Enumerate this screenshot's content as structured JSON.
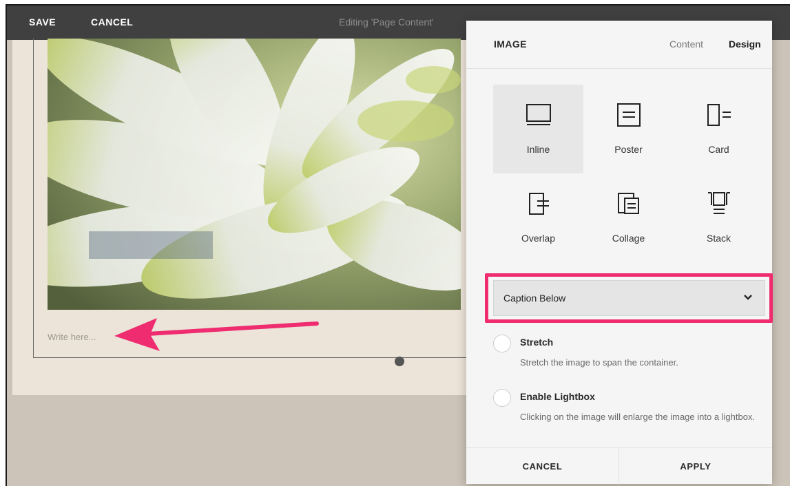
{
  "topbar": {
    "save_label": "SAVE",
    "cancel_label": "CANCEL",
    "editing_label": "Editing 'Page Content'"
  },
  "editor": {
    "caption_placeholder": "Write here..."
  },
  "panel": {
    "title": "IMAGE",
    "tabs": [
      {
        "label": "Content",
        "active": false
      },
      {
        "label": "Design",
        "active": true
      }
    ],
    "layouts": [
      {
        "label": "Inline",
        "icon": "inline-layout-icon",
        "selected": true
      },
      {
        "label": "Poster",
        "icon": "poster-layout-icon",
        "selected": false
      },
      {
        "label": "Card",
        "icon": "card-layout-icon",
        "selected": false
      },
      {
        "label": "Overlap",
        "icon": "overlap-layout-icon",
        "selected": false
      },
      {
        "label": "Collage",
        "icon": "collage-layout-icon",
        "selected": false
      },
      {
        "label": "Stack",
        "icon": "stack-layout-icon",
        "selected": false
      }
    ],
    "caption_select": {
      "value": "Caption Below",
      "icon": "chevron-down-icon"
    },
    "options": [
      {
        "title": "Stretch",
        "description": "Stretch the image to span the container.",
        "checked": false
      },
      {
        "title": "Enable Lightbox",
        "description": "Clicking on the image will enlarge the image into a lightbox.",
        "checked": false
      }
    ],
    "footer": {
      "cancel_label": "CANCEL",
      "apply_label": "APPLY"
    }
  },
  "colors": {
    "highlight": "#ee2c6f",
    "topbar": "#404040",
    "canvas": "#ece4d8"
  }
}
